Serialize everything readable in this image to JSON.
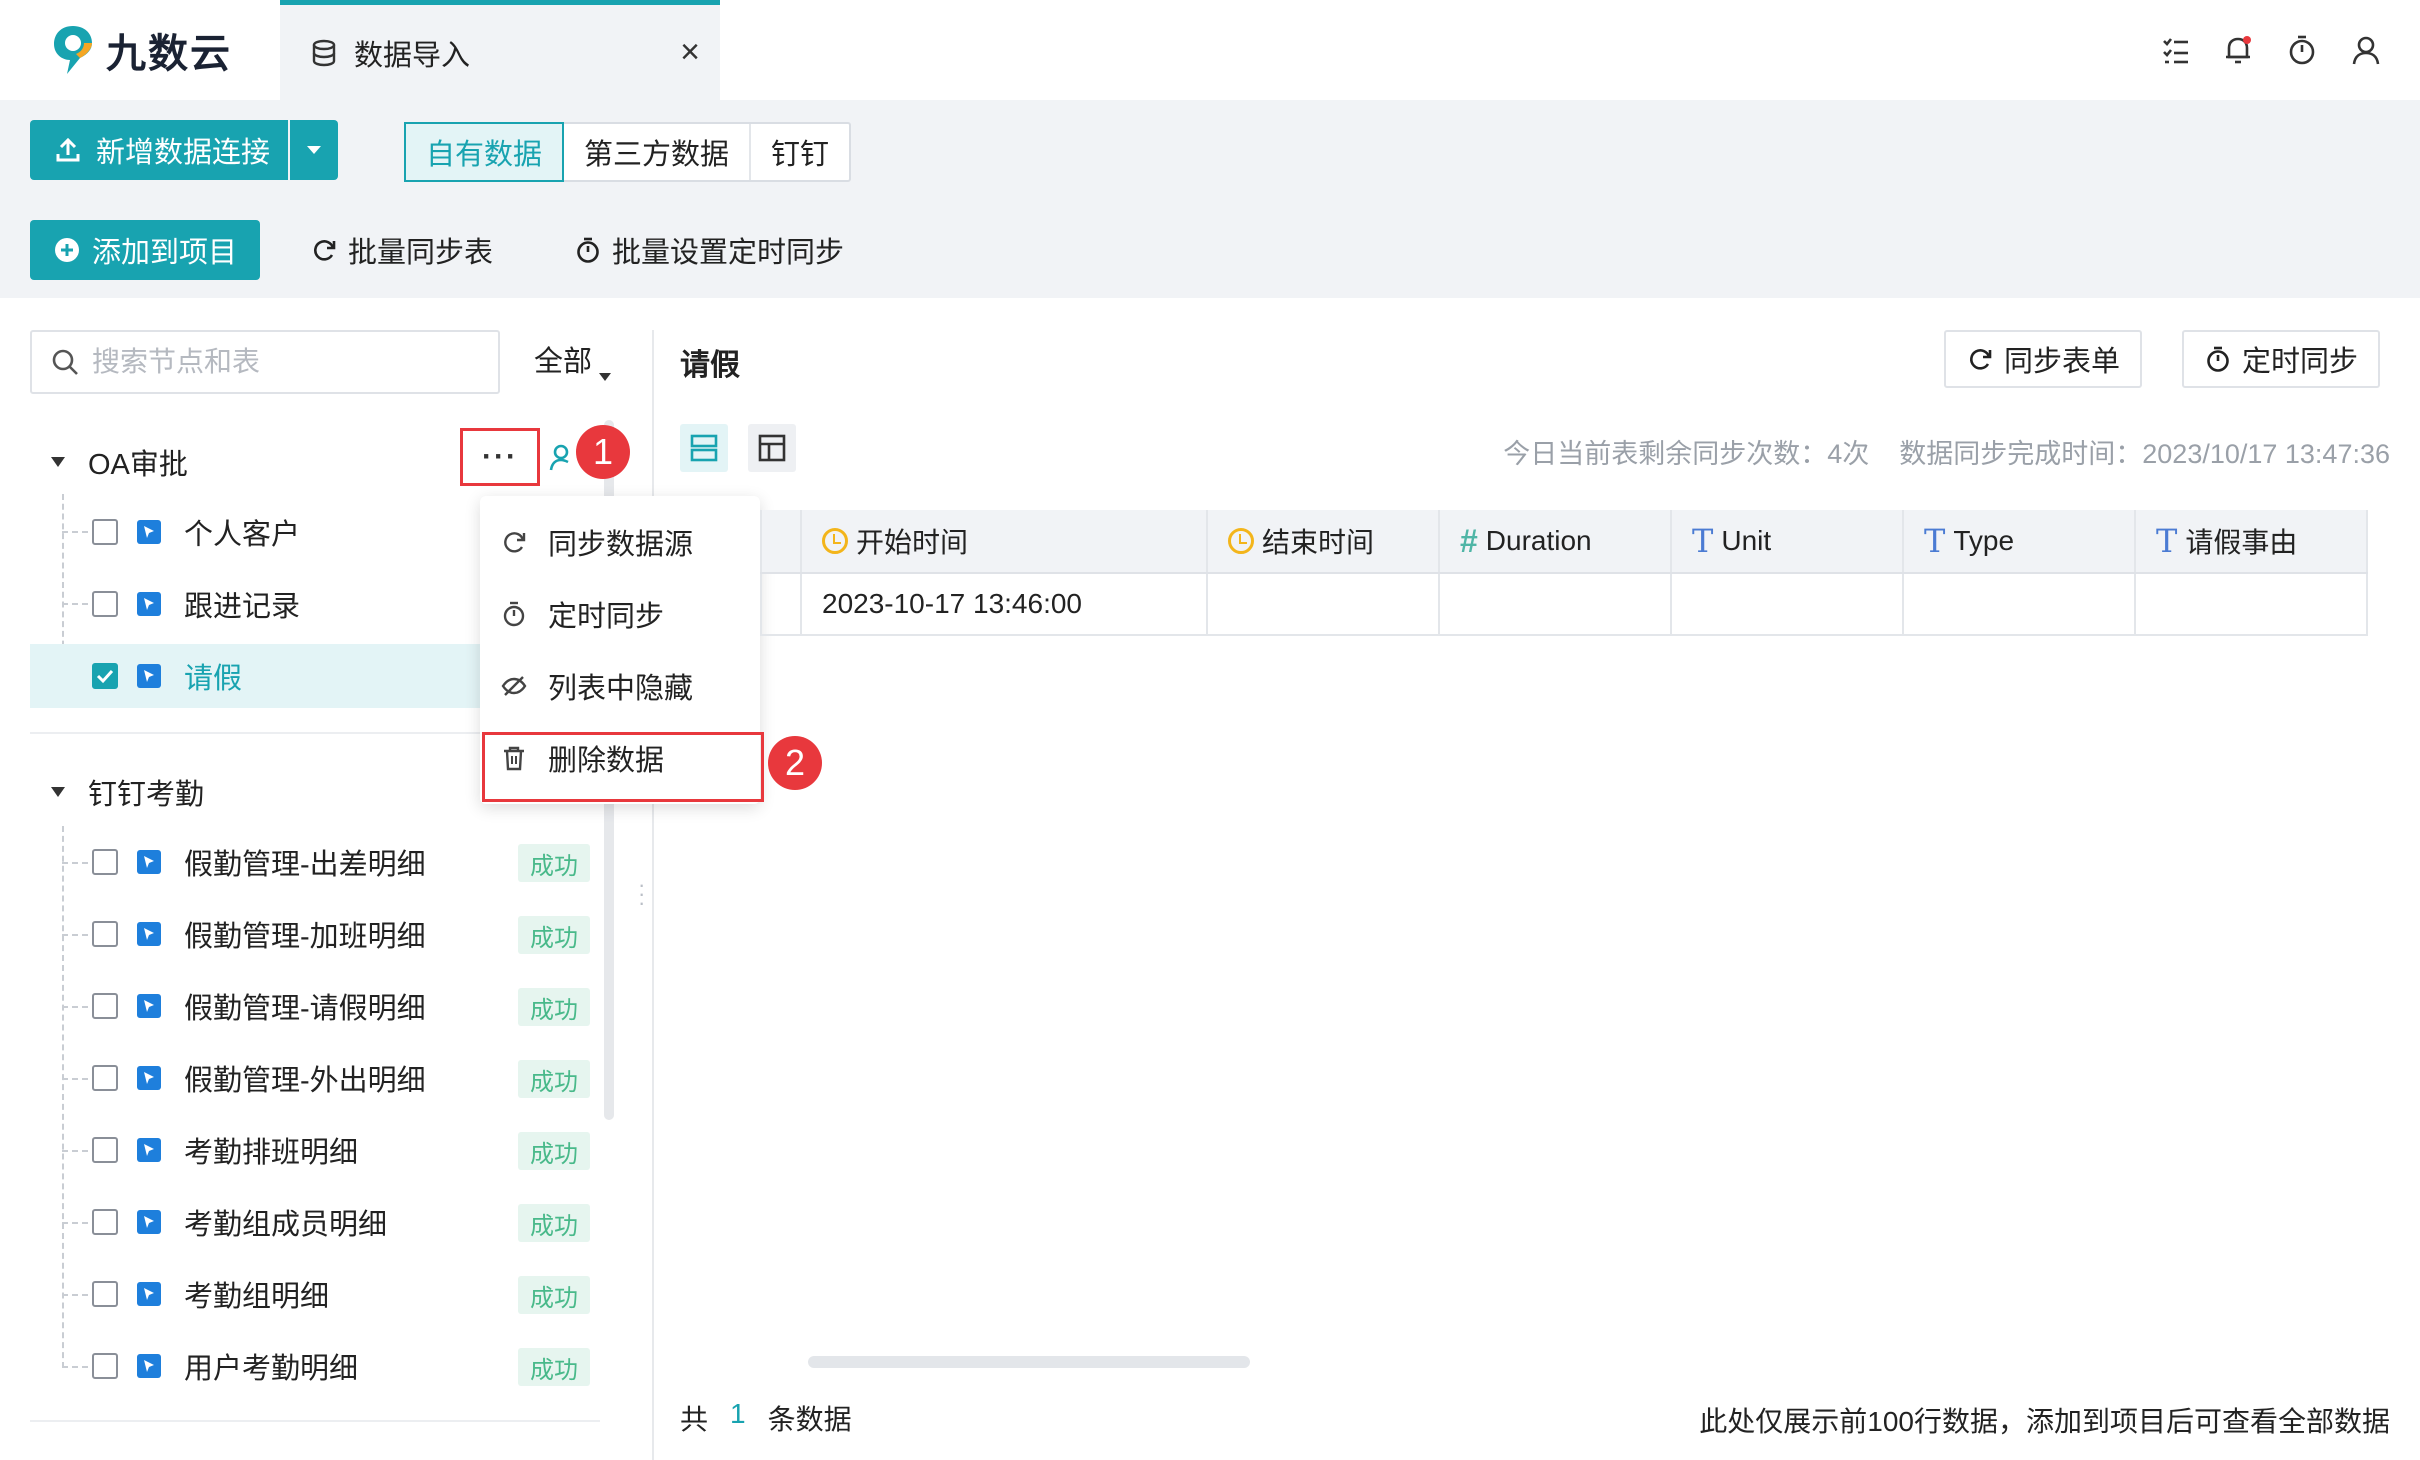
{
  "app": {
    "brand": "九数云",
    "tab_title": "数据导入",
    "tab_close": "×"
  },
  "top_icons": [
    "task-list-icon",
    "bell-icon",
    "timer-icon",
    "user-icon"
  ],
  "toolbar": {
    "new_connection_label": "新增数据连接",
    "source_tabs": [
      "自有数据",
      "第三方数据",
      "钉钉"
    ],
    "active_source_tab": "自有数据",
    "add_to_project_label": "添加到项目",
    "batch_sync_label": "批量同步表",
    "batch_schedule_label": "批量设置定时同步"
  },
  "sidebar": {
    "search_placeholder": "搜索节点和表",
    "filter_label": "全部",
    "groups": [
      {
        "name": "OA审批",
        "items": [
          {
            "label": "个人客户",
            "checked": false,
            "selected": false,
            "badge": ""
          },
          {
            "label": "跟进记录",
            "checked": false,
            "selected": false,
            "badge": ""
          },
          {
            "label": "请假",
            "checked": true,
            "selected": true,
            "badge": ""
          }
        ]
      },
      {
        "name": "钉钉考勤",
        "items": [
          {
            "label": "假勤管理-出差明细",
            "checked": false,
            "badge": "成功"
          },
          {
            "label": "假勤管理-加班明细",
            "checked": false,
            "badge": "成功"
          },
          {
            "label": "假勤管理-请假明细",
            "checked": false,
            "badge": "成功"
          },
          {
            "label": "假勤管理-外出明细",
            "checked": false,
            "badge": "成功"
          },
          {
            "label": "考勤排班明细",
            "checked": false,
            "badge": "成功"
          },
          {
            "label": "考勤组成员明细",
            "checked": false,
            "badge": "成功"
          },
          {
            "label": "考勤组明细",
            "checked": false,
            "badge": "成功"
          },
          {
            "label": "用户考勤明细",
            "checked": false,
            "badge": "成功"
          }
        ]
      }
    ]
  },
  "more_button_label": "···",
  "callouts": [
    "1",
    "2"
  ],
  "context_menu": {
    "items": [
      {
        "label": "同步数据源",
        "icon": "refresh-icon"
      },
      {
        "label": "定时同步",
        "icon": "timer-icon"
      },
      {
        "label": "列表中隐藏",
        "icon": "eye-off-icon"
      },
      {
        "label": "删除数据",
        "icon": "trash-icon"
      }
    ]
  },
  "detail": {
    "title": "请假",
    "sync_table_label": "同步表单",
    "schedule_sync_label": "定时同步",
    "remaining_syncs": "今日当前表剩余同步次数：4次",
    "sync_complete_time": "数据同步完成时间：2023/10/17 13:47:36",
    "columns": [
      {
        "label": "",
        "type": ""
      },
      {
        "label": "开始时间",
        "type": "time"
      },
      {
        "label": "结束时间",
        "type": "time"
      },
      {
        "label": "Duration",
        "type": "number"
      },
      {
        "label": "Unit",
        "type": "text"
      },
      {
        "label": "Type",
        "type": "text"
      },
      {
        "label": "请假事由",
        "type": "text"
      }
    ],
    "rows": [
      [
        "",
        "2023-10-17 13:46:00",
        "",
        "",
        "",
        "",
        ""
      ]
    ],
    "footer_prefix": "共",
    "footer_count": "1",
    "footer_suffix": "条数据",
    "footer_note": "此处仅展示前100行数据，添加到项目后可查看全部数据"
  },
  "colors": {
    "accent": "#18a3b0",
    "highlight_red": "#e8383d",
    "success_text": "#49b98a"
  }
}
